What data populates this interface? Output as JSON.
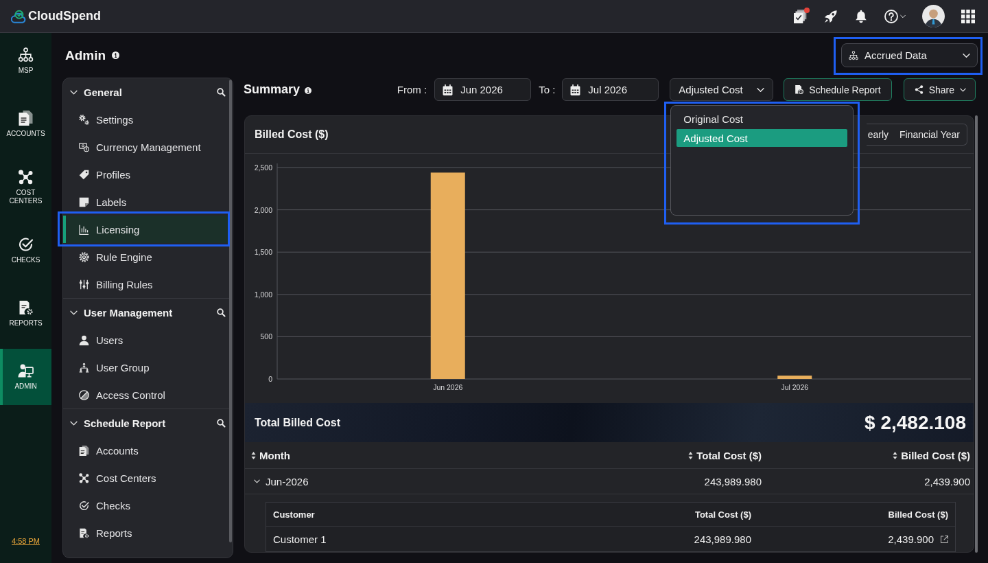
{
  "topbar": {
    "brand": "CloudSpend",
    "tasks_unread": true
  },
  "rail": {
    "items": [
      {
        "label": "MSP",
        "selected": false
      },
      {
        "label": "ACCOUNTS",
        "selected": false
      },
      {
        "label": "COST CENTERS",
        "selected": false
      },
      {
        "label": "CHECKS",
        "selected": false
      },
      {
        "label": "REPORTS",
        "selected": false
      },
      {
        "label": "ADMIN",
        "selected": true
      }
    ],
    "time": "4:58 PM"
  },
  "page": {
    "title": "Admin",
    "data_source": {
      "value": "Accrued Data",
      "highlighted": true
    }
  },
  "admin_menu": {
    "sections": [
      {
        "title": "General",
        "expanded": true,
        "items": [
          {
            "label": "Settings",
            "selected": false,
            "highlighted": false
          },
          {
            "label": "Currency Management",
            "selected": false,
            "highlighted": false
          },
          {
            "label": "Profiles",
            "selected": false,
            "highlighted": false
          },
          {
            "label": "Labels",
            "selected": false,
            "highlighted": false
          },
          {
            "label": "Licensing",
            "selected": true,
            "highlighted": true
          },
          {
            "label": "Rule Engine",
            "selected": false,
            "highlighted": false
          },
          {
            "label": "Billing Rules",
            "selected": false,
            "highlighted": false
          }
        ]
      },
      {
        "title": "User Management",
        "expanded": true,
        "items": [
          {
            "label": "Users",
            "selected": false,
            "highlighted": false
          },
          {
            "label": "User Group",
            "selected": false,
            "highlighted": false
          },
          {
            "label": "Access Control",
            "selected": false,
            "highlighted": false
          }
        ]
      },
      {
        "title": "Schedule Report",
        "expanded": true,
        "items": [
          {
            "label": "Accounts",
            "selected": false,
            "highlighted": false
          },
          {
            "label": "Cost Centers",
            "selected": false,
            "highlighted": false
          },
          {
            "label": "Checks",
            "selected": false,
            "highlighted": false
          },
          {
            "label": "Reports",
            "selected": false,
            "highlighted": false
          }
        ]
      }
    ]
  },
  "summary": {
    "title": "Summary",
    "from_label": "From :",
    "from": "Jun 2026",
    "to_label": "To :",
    "to": "Jul 2026",
    "cost_select": {
      "value": "Adjusted Cost",
      "open": true,
      "highlighted": true,
      "options": [
        {
          "label": "Original Cost",
          "selected": false
        },
        {
          "label": "Adjusted Cost",
          "selected": true
        }
      ]
    },
    "buttons": [
      {
        "label": "Schedule Report",
        "kind": "schedule"
      },
      {
        "label": "Share",
        "kind": "share"
      }
    ]
  },
  "chart_card": {
    "period_tabs": [
      {
        "label": "early",
        "selected": false
      },
      {
        "label": "Financial Year",
        "selected": false
      }
    ],
    "chart_data": {
      "type": "bar",
      "title": "Billed Cost ($)",
      "categories": [
        "Jun 2026",
        "Jul 2026"
      ],
      "values": [
        2440,
        40
      ],
      "ylim": [
        0,
        2500
      ],
      "yticks": [
        0,
        500,
        {
          "value": 1000,
          "label": "1,000"
        },
        {
          "value": 1500,
          "label": "1,500"
        },
        {
          "value": 2000,
          "label": "2,000"
        },
        {
          "value": 2500,
          "label": "2,500"
        }
      ],
      "grid": true
    }
  },
  "total": {
    "label": "Total Billed Cost",
    "value": "$ 2,482.108"
  },
  "table": {
    "columns": [
      "Month",
      "Total Cost ($)",
      "Billed Cost ($)"
    ],
    "rows": [
      {
        "cells": [
          "Jun-2026",
          "243,989.980",
          "2,439.900"
        ],
        "expanded": true,
        "details": {
          "columns": [
            "Customer",
            "Total Cost ($)",
            "Billed Cost ($)"
          ],
          "rows": [
            {
              "cells": [
                "Customer 1",
                "243,989.980",
                "2,439.900"
              ]
            }
          ]
        }
      }
    ]
  }
}
